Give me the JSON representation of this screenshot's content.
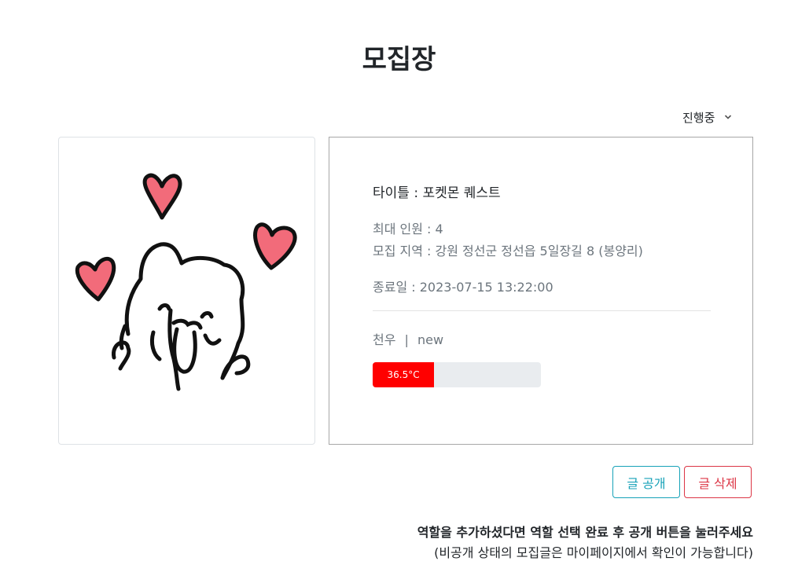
{
  "page": {
    "title": "모집장"
  },
  "status": {
    "selected": "진행중"
  },
  "image": {
    "alt": "cute-bear-with-hearts-drawing"
  },
  "post": {
    "title": "타이틀 : 포켓몬 퀘스트",
    "max_members": "최대 인원 : 4",
    "region": "모집 지역 : 강원 정선군 정선읍 5일장길 8 (봉양리)",
    "end_date": "종료일 : 2023-07-15 13:22:00",
    "author": "천우",
    "separator": "|",
    "author_tag": "new"
  },
  "temperature": {
    "label": "36.5°C",
    "value": 36.5,
    "fill_fraction": 0.365,
    "color": "#ff0000"
  },
  "actions": {
    "public_label": "글 공개",
    "delete_label": "글 삭제"
  },
  "notice": {
    "line1": "역할을 추가하셨다면 역할 선택 완료 후 공개 버튼을 눌러주세요",
    "line2": "(비공개 상태의 모집글은 마이페이지에서 확인이 가능합니다)"
  }
}
